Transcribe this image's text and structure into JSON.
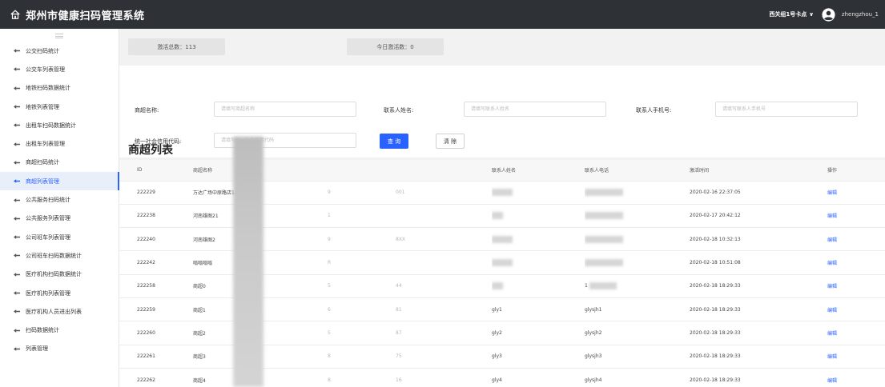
{
  "header": {
    "app_title": "郑州市健康扫码管理系统",
    "org_selector": "西关组1号卡点",
    "username": "zhengzhou_1"
  },
  "sidebar": {
    "items": [
      {
        "label": "公交扫码统计"
      },
      {
        "label": "公交车列表管理"
      },
      {
        "label": "地铁扫码数据统计"
      },
      {
        "label": "地铁列表管理"
      },
      {
        "label": "出租车扫码数据统计"
      },
      {
        "label": "出租车列表管理"
      },
      {
        "label": "商超扫码统计"
      },
      {
        "label": "商超列表管理",
        "active": true
      },
      {
        "label": "公共服务扫码统计"
      },
      {
        "label": "公共服务列表管理"
      },
      {
        "label": "公司班车列表管理"
      },
      {
        "label": "公司班车扫码数据统计"
      },
      {
        "label": "医疗机构扫码数据统计"
      },
      {
        "label": "医疗机构列表管理"
      },
      {
        "label": "医疗机构人员进出列表"
      },
      {
        "label": "扫码数据统计"
      },
      {
        "label": "列表管理"
      }
    ]
  },
  "stats": {
    "total_label": "激活总数：113",
    "today_label": "今日激活数：0"
  },
  "search": {
    "store_name_label": "商超名称:",
    "store_name_placeholder": "请填写商超名称",
    "contact_name_label": "联系人姓名:",
    "contact_name_placeholder": "请填写联系人姓名",
    "contact_phone_label": "联系人手机号:",
    "contact_phone_placeholder": "请填写联系人手机号",
    "credit_code_label": "统一社会信用代码:",
    "credit_code_placeholder": "请填写统一社会信用代码",
    "query_button": "查 询",
    "clear_button": "清 除"
  },
  "list": {
    "title": "商超列表",
    "columns": [
      "ID",
      "商超名称",
      "",
      "联系人姓名",
      "联系人电话",
      "激活时间",
      "操作"
    ],
    "rows": [
      {
        "id": "222229",
        "name": "万达广场中原路店12",
        "code": "001",
        "code_head": "9",
        "contact": "",
        "phone": "",
        "time": "2020-02-16 22:37:05",
        "op": "编辑"
      },
      {
        "id": "222238",
        "name": "河南雄图21",
        "code": "",
        "code_head": "1",
        "contact": "",
        "phone": "",
        "time": "2020-02-17 20:42:12",
        "op": "编辑"
      },
      {
        "id": "222240",
        "name": "河南雄图2",
        "code": "8XX",
        "code_head": "9",
        "contact": "",
        "phone": "",
        "time": "2020-02-18 10:32:13",
        "op": "编辑"
      },
      {
        "id": "222242",
        "name": "嗡嗡嗡嗡",
        "code": "",
        "code_head": "R",
        "contact": "",
        "phone": "",
        "time": "2020-02-18 10:51:08",
        "op": "编辑"
      },
      {
        "id": "222258",
        "name": "商超0",
        "code": "44",
        "code_head": "5",
        "contact": "",
        "phone": "1",
        "time": "2020-02-18 18:29:33",
        "op": "编辑"
      },
      {
        "id": "222259",
        "name": "商超1",
        "code": "81",
        "code_head": "6",
        "contact": "gly1",
        "phone": "glysjh1",
        "time": "2020-02-18 18:29:33",
        "op": "编辑"
      },
      {
        "id": "222260",
        "name": "商超2",
        "code": "87",
        "code_head": "5",
        "contact": "gly2",
        "phone": "glysjh2",
        "time": "2020-02-18 18:29:33",
        "op": "编辑"
      },
      {
        "id": "222261",
        "name": "商超3",
        "code": "75",
        "code_head": "8",
        "contact": "gly3",
        "phone": "glysjh3",
        "time": "2020-02-18 18:29:33",
        "op": "编辑"
      },
      {
        "id": "222262",
        "name": "商超4",
        "code": "16",
        "code_head": "8",
        "contact": "gly4",
        "phone": "glysjh4",
        "time": "2020-02-18 18:29:33",
        "op": "编辑"
      }
    ]
  },
  "icons": {
    "home": "home-icon",
    "avatar": "user-avatar-icon",
    "menu": "arrow-bullet-icon",
    "chevron": "chevron-down-icon"
  },
  "colors": {
    "header_bg": "#2e3135",
    "accent": "#2962ff",
    "active_menu_bg": "#e9eefb"
  }
}
